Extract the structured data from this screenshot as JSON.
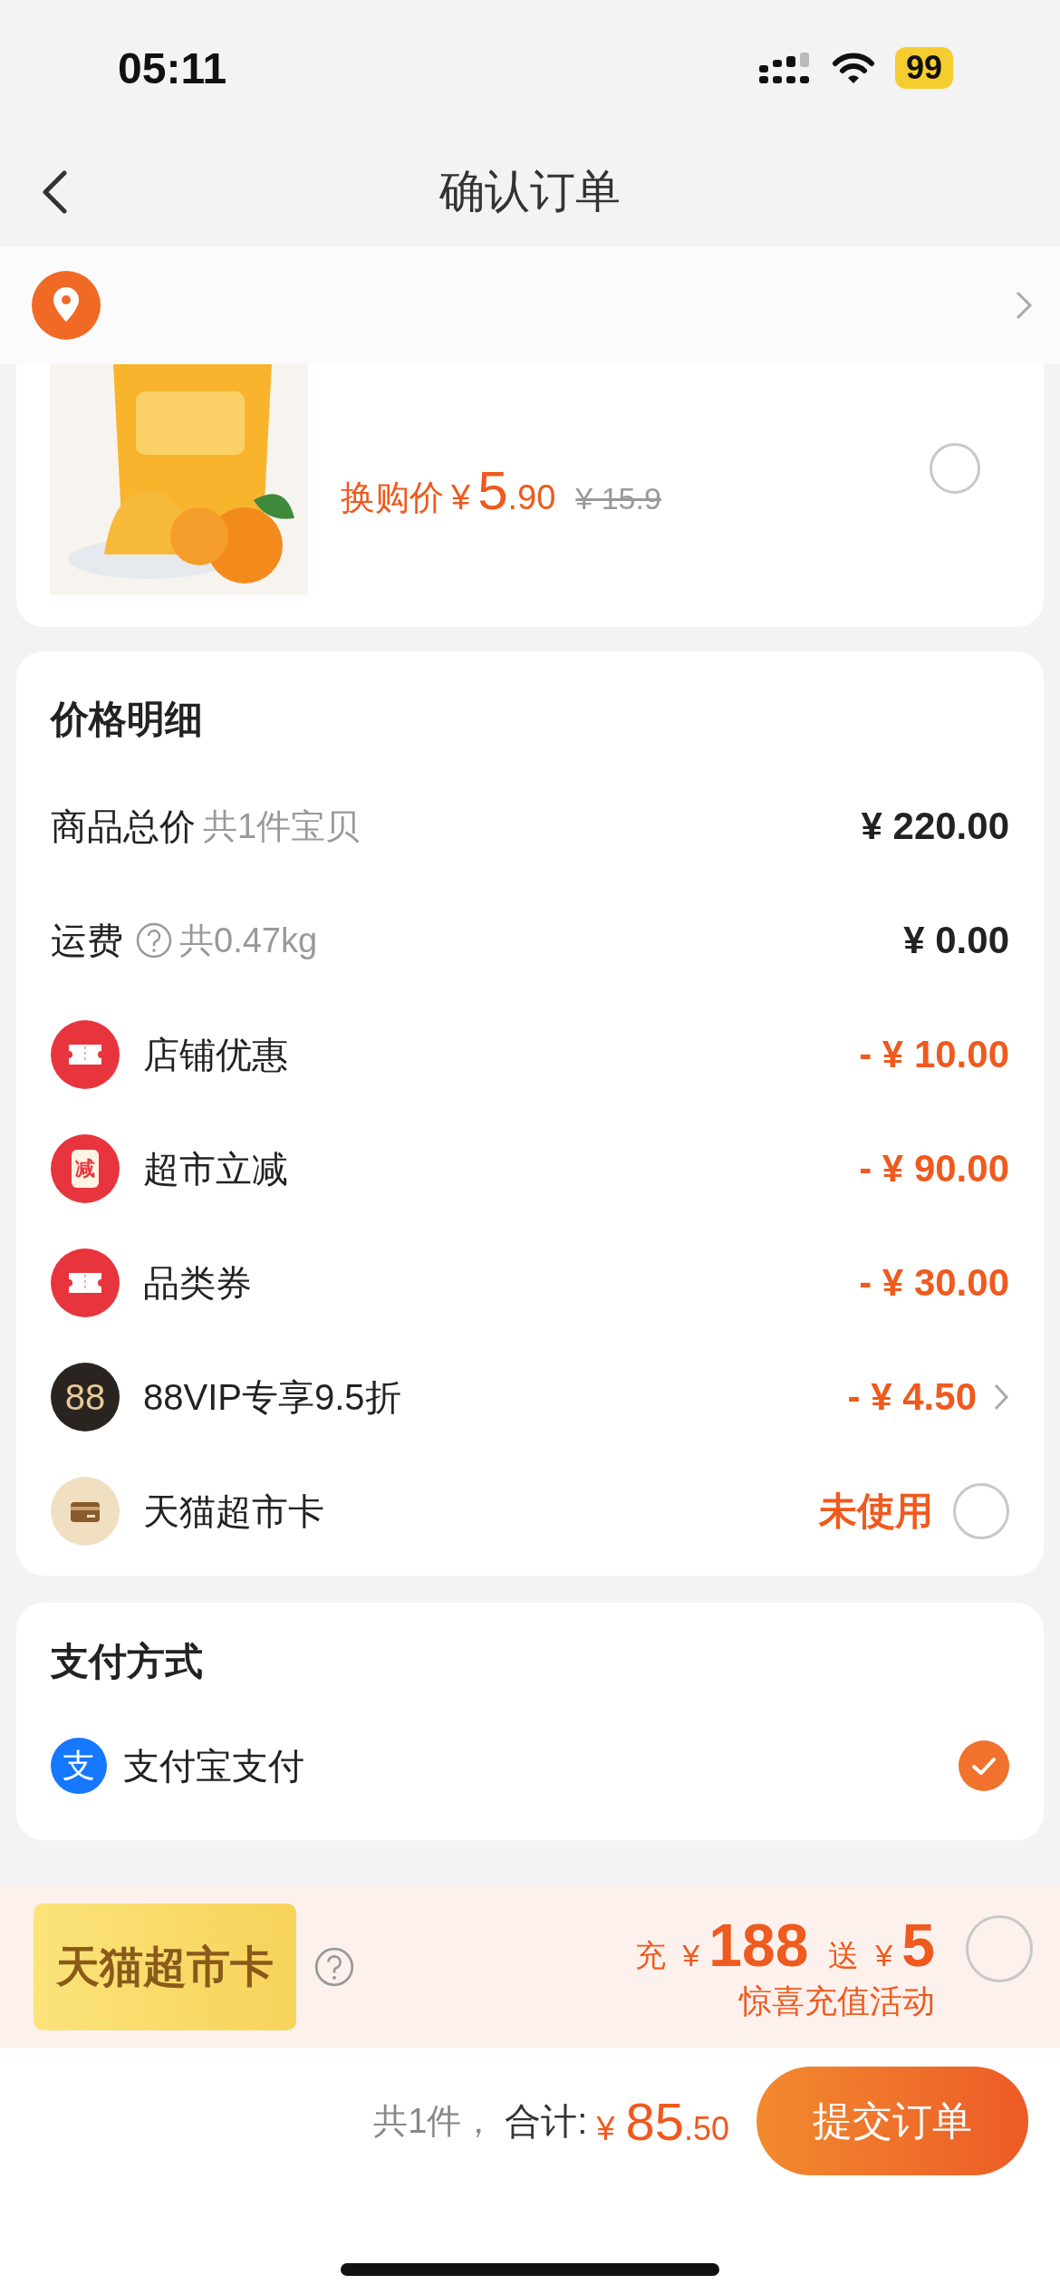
{
  "status_bar": {
    "time": "05:11",
    "battery": "99"
  },
  "nav": {
    "title": "确认订单"
  },
  "product": {
    "price_label": "换购价",
    "currency": "¥",
    "price_int": "5",
    "price_dec": ".90",
    "original_price": "¥ 15.9",
    "selected": false
  },
  "price_details": {
    "title": "价格明细",
    "rows": [
      {
        "kind": "plain",
        "label": "商品总价",
        "note": "共1件宝贝",
        "amount": "¥ 220.00"
      },
      {
        "kind": "plain",
        "label": "运费",
        "help": true,
        "note": "共0.47kg",
        "amount": "¥ 0.00"
      },
      {
        "kind": "ticket",
        "label": "店铺优惠",
        "amount": "- ¥ 10.00"
      },
      {
        "kind": "badge",
        "icon_text": "减",
        "label": "超市立减",
        "amount": "- ¥ 90.00"
      },
      {
        "kind": "ticket",
        "label": "品类券",
        "amount": "- ¥ 30.00"
      },
      {
        "kind": "vip",
        "icon_text": "88",
        "label": "88VIP专享9.5折",
        "amount": "- ¥ 4.50",
        "chevron": true
      },
      {
        "kind": "card",
        "label": "天猫超市卡",
        "status": "未使用",
        "selected": false
      }
    ]
  },
  "payment": {
    "title": "支付方式",
    "methods": [
      {
        "label": "支付宝支付",
        "icon_text": "支",
        "selected": true
      }
    ]
  },
  "promo": {
    "card_label": "天猫超市卡",
    "charge_label": "充",
    "charge_currency": "¥",
    "charge_amount": "188",
    "bonus_label": "送",
    "bonus_currency": "¥",
    "bonus_amount": "5",
    "subtitle": "惊喜充值活动",
    "selected": false
  },
  "footer": {
    "count": "共1件，",
    "total_label": "合计:",
    "currency": "¥",
    "total_int": "85",
    "total_dec": ".50",
    "submit": "提交订单"
  }
}
